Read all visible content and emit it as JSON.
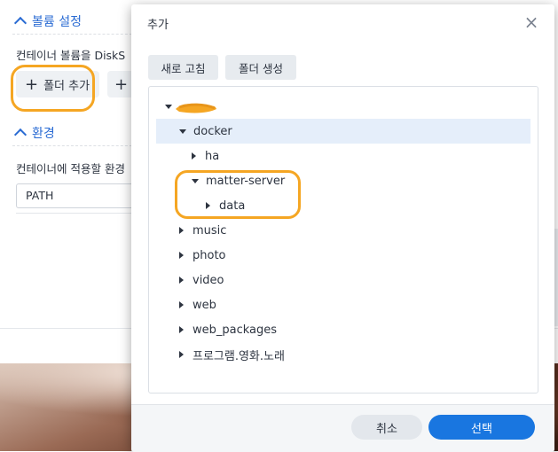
{
  "background": {
    "volume_section_title": "볼륨 설정",
    "volume_description": "컨테이너 볼륨을 DiskS",
    "add_folder_button": "폴더 추가",
    "env_section_title": "환경",
    "env_description": "컨테이너에 적용할 환경",
    "env_row_value": "PATH"
  },
  "dialog": {
    "title": "추가",
    "close_glyph": "×",
    "toolbar": {
      "refresh_label": "새로 고침",
      "create_folder_label": "폴더 생성"
    },
    "tree": {
      "items": [
        {
          "label": "docker"
        },
        {
          "label": "ha"
        },
        {
          "label": "matter-server"
        },
        {
          "label": "data"
        },
        {
          "label": "music"
        },
        {
          "label": "photo"
        },
        {
          "label": "video"
        },
        {
          "label": "web"
        },
        {
          "label": "web_packages"
        },
        {
          "label": "프로그램.영화.노래"
        }
      ],
      "selected": "docker"
    },
    "footer": {
      "cancel_label": "취소",
      "select_label": "선택"
    }
  },
  "colors": {
    "accent": "#1976e0",
    "section_blue": "#2a6bd3",
    "annotation_orange": "#f5a623",
    "selected_row": "#e5eefa"
  }
}
